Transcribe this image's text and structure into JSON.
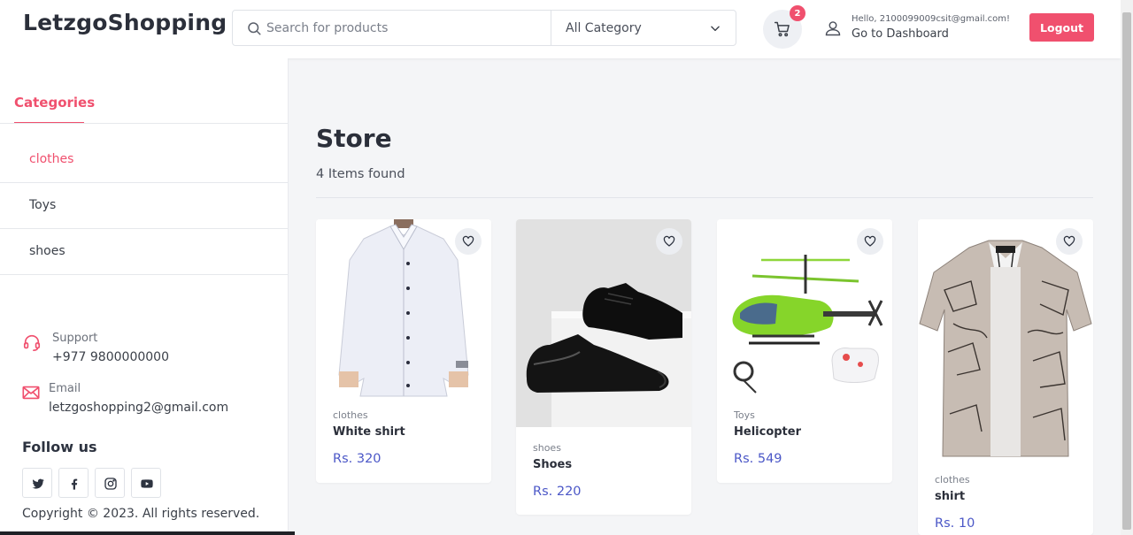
{
  "header": {
    "logo": "LetzgoShopping",
    "search_placeholder": "Search for products",
    "category_select": "All Category",
    "cart_count": "2",
    "user_hello": "Hello, 2100099009csit@gmail.com!",
    "dashboard_link": "Go to Dashboard",
    "logout_label": "Logout"
  },
  "sidebar": {
    "categories_title": "Categories",
    "categories": [
      {
        "label": "clothes",
        "active": true
      },
      {
        "label": "Toys",
        "active": false
      },
      {
        "label": "shoes",
        "active": false
      }
    ],
    "support_label": "Support",
    "support_value": "+977 9800000000",
    "email_label": "Email",
    "email_value": "letzgoshopping2@gmail.com",
    "follow_title": "Follow us",
    "social": [
      "twitter-icon",
      "facebook-icon",
      "instagram-icon",
      "youtube-icon"
    ],
    "copyright": "Copyright © 2023. All rights reserved."
  },
  "main": {
    "title": "Store",
    "items_found": "4 Items found",
    "products": [
      {
        "category": "clothes",
        "name": "White shirt",
        "price": "Rs. 320"
      },
      {
        "category": "shoes",
        "name": "Shoes",
        "price": "Rs. 220"
      },
      {
        "category": "Toys",
        "name": "Helicopter",
        "price": "Rs. 549"
      },
      {
        "category": "clothes",
        "name": "shirt",
        "price": "Rs. 10"
      }
    ]
  },
  "colors": {
    "accent": "#f0506e",
    "price": "#4b57c7"
  }
}
